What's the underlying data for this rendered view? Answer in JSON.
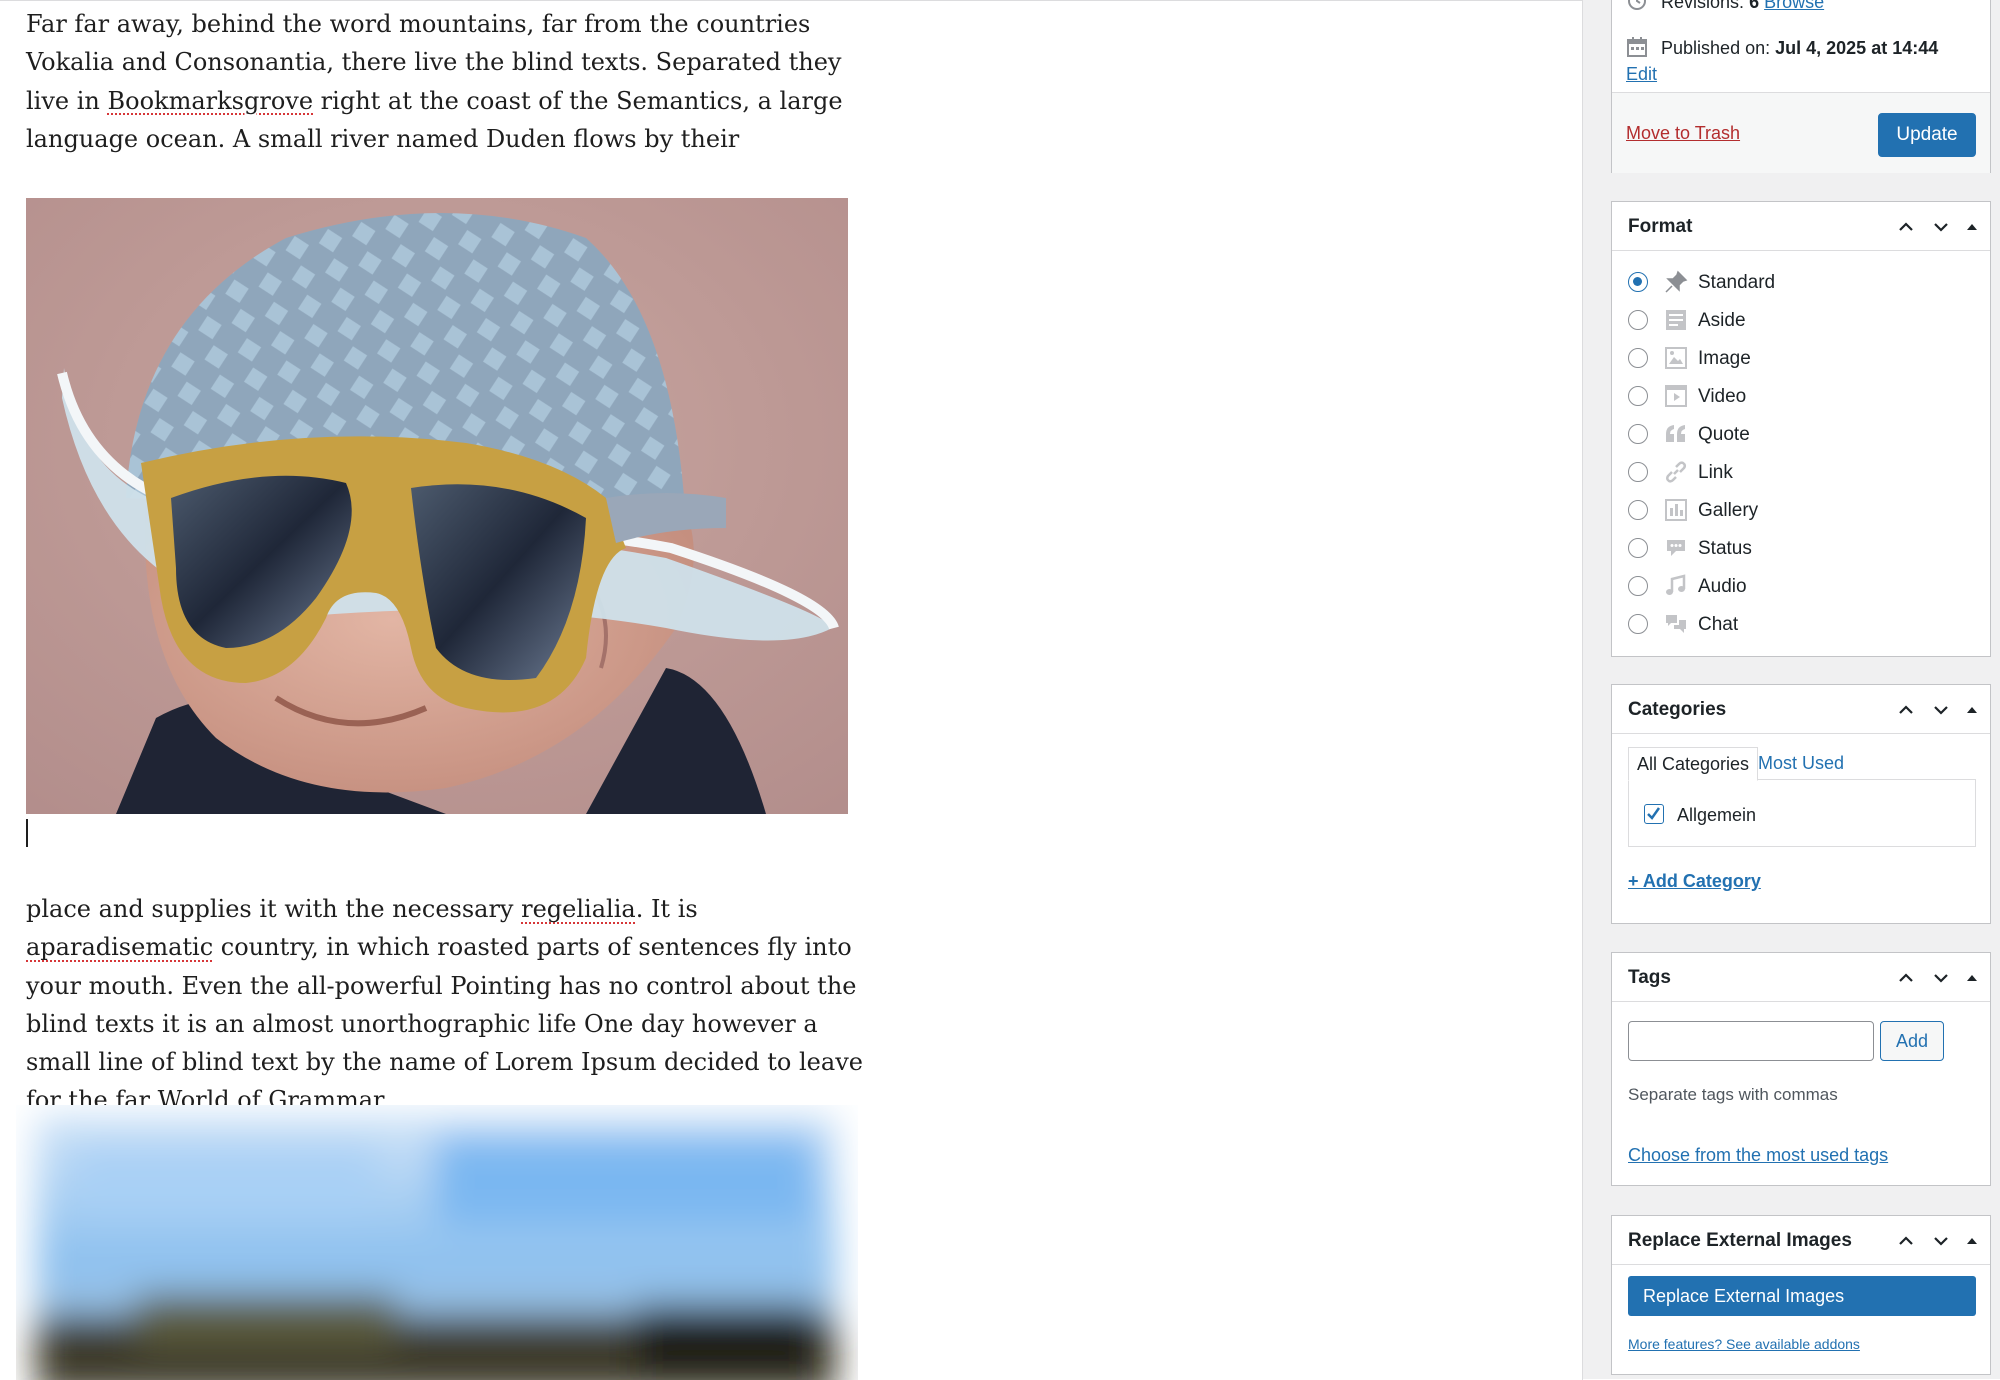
{
  "editor": {
    "paragraph1": {
      "t1": "Far far away, behind the word mountains, far from the countries Vokalia and Consonantia, there live the blind texts. Separated they live in ",
      "sp1": "Bookmarksgrove",
      "t2": " right at the coast of the Semantics, a large language ocean. A small river named Duden flows by their"
    },
    "paragraph2": {
      "t1": "place and supplies it with the necessary ",
      "sp1": "regelialia",
      "t2": ". It is ",
      "sp2": "aparadisematic",
      "t3": " country, in which roasted parts of sentences fly into your mouth. Even the all-powerful Pointing has no control about the blind texts it is an almost unorthographic life One day however a small line of blind text by the name of Lorem Ipsum decided to leave for the far World of Grammar."
    }
  },
  "publish": {
    "revisions_label": "Revisions:",
    "revisions_count": "6",
    "browse_link": "Browse",
    "published_label": "Published on:",
    "published_date": "Jul 4, 2025 at 14:44",
    "edit_link": "Edit",
    "trash_link": "Move to Trash",
    "update_button": "Update"
  },
  "format": {
    "title": "Format",
    "selected": "Standard",
    "options": [
      {
        "label": "Standard",
        "icon": "pin-icon"
      },
      {
        "label": "Aside",
        "icon": "aside-icon"
      },
      {
        "label": "Image",
        "icon": "image-icon"
      },
      {
        "label": "Video",
        "icon": "video-icon"
      },
      {
        "label": "Quote",
        "icon": "quote-icon"
      },
      {
        "label": "Link",
        "icon": "link-icon"
      },
      {
        "label": "Gallery",
        "icon": "gallery-icon"
      },
      {
        "label": "Status",
        "icon": "status-icon"
      },
      {
        "label": "Audio",
        "icon": "audio-icon"
      },
      {
        "label": "Chat",
        "icon": "chat-icon"
      }
    ]
  },
  "categories": {
    "title": "Categories",
    "tab_all": "All Categories",
    "tab_most_used": "Most Used",
    "items": [
      {
        "label": "Allgemein",
        "checked": true
      }
    ],
    "add_link": "+ Add Category"
  },
  "tags": {
    "title": "Tags",
    "input_value": "",
    "add_button": "Add",
    "hint": "Separate tags with commas",
    "choose_link": "Choose from the most used tags"
  },
  "replace_images": {
    "title": "Replace External Images",
    "button": "Replace External Images",
    "more_link": "More features? See available addons"
  },
  "colors": {
    "accent": "#2271b1",
    "trash": "#b32d2e",
    "sidebar_bg": "#f0f0f1",
    "border": "#c3c4c7"
  }
}
